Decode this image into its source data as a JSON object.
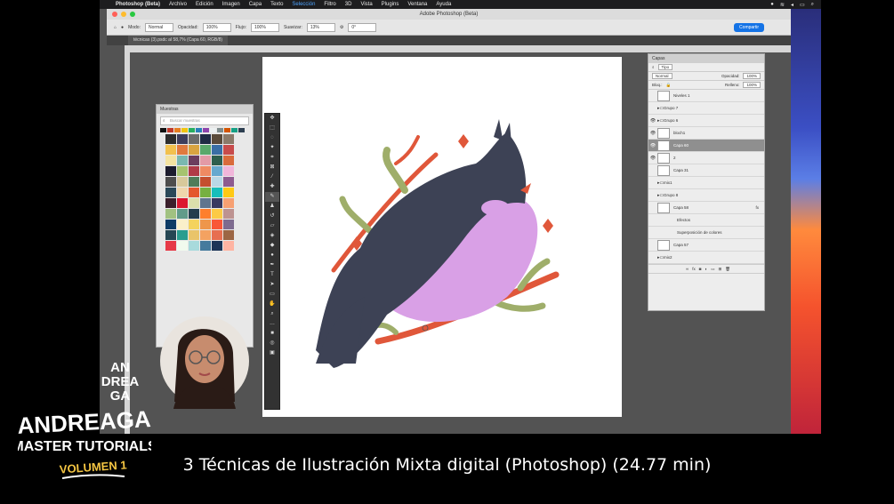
{
  "menubar": {
    "app": "Photoshop (Beta)",
    "items": [
      "Archivo",
      "Edición",
      "Imagen",
      "Capa",
      "Texto",
      "Selección",
      "Filtro",
      "3D",
      "Vista",
      "Plugins",
      "Ventana",
      "Ayuda"
    ],
    "active_item": "Selección"
  },
  "window": {
    "title": "Adobe Photoshop (Beta)",
    "tab": "técnicas (3).psdc al 58,7% (Capa 60, RGB/8)"
  },
  "options": {
    "mode_label": "Modo:",
    "mode": "Normal",
    "opacity_label": "Opacidad:",
    "opacity": "100%",
    "flow_label": "Flujo:",
    "flow": "100%",
    "smooth_label": "Suavizar:",
    "smooth": "13%",
    "angle": "0°",
    "share": "Compartir"
  },
  "swatches": {
    "title": "Muestras",
    "search_placeholder": "Buscar muestras",
    "colors": [
      "#2d2d2d",
      "#3d3d5c",
      "#6b6b6b",
      "#1f2a44",
      "#5a4a3a",
      "#8a7a6a",
      "#f2c14e",
      "#e07a3f",
      "#d9a441",
      "#5aa86b",
      "#3a6ea5",
      "#c74b4b",
      "#f4e3a1",
      "#7ab8b0",
      "#6b3d5e",
      "#e39aa6",
      "#2e5e4e",
      "#d96b3b",
      "#1c1c2e",
      "#a6c36f",
      "#b03a48",
      "#ef8a62",
      "#67a9cf",
      "#f1b6da",
      "#4d4d4d",
      "#d8c99b",
      "#4f7c5a",
      "#c44f2f",
      "#b9d8e6",
      "#8e5b8f",
      "#2a4858",
      "#efd6ac",
      "#e4572e",
      "#76b041",
      "#17bebb",
      "#ffc914",
      "#3b1f2b",
      "#db162f",
      "#dbdfac",
      "#5f758e",
      "#383961",
      "#f7a072",
      "#a1c181",
      "#619b8a",
      "#233d4d",
      "#fe7f2d",
      "#fcca46",
      "#bd9391",
      "#0d3b66",
      "#faf0ca",
      "#f4d35e",
      "#ee964b",
      "#f95738",
      "#7e6b8f",
      "#264653",
      "#2a9d8f",
      "#e9c46a",
      "#f4a261",
      "#e76f51",
      "#9c6644",
      "#e63946",
      "#f1faee",
      "#a8dadc",
      "#457b9d",
      "#1d3557",
      "#ffb4a2"
    ],
    "top_strip": [
      "#111",
      "#c0392b",
      "#e67e22",
      "#f1c40f",
      "#27ae60",
      "#2980b9",
      "#8e44ad",
      "#ecf0f1",
      "#7f8c8d",
      "#d35400",
      "#16a085",
      "#2c3e50"
    ]
  },
  "layers": {
    "title": "Capas",
    "filter": "Tipo",
    "blend": "Normal",
    "opacity_label": "Opacidad:",
    "opacity": "100%",
    "lock_label": "Bloq.:",
    "fill_label": "Relleno:",
    "fill": "100%",
    "rows": [
      {
        "name": "Niveles 1",
        "visible": false,
        "kind": "adjust"
      },
      {
        "name": "Grupo 7",
        "visible": false,
        "kind": "group"
      },
      {
        "name": "Grupo 6",
        "visible": true,
        "kind": "group"
      },
      {
        "name": "bloch1",
        "visible": true,
        "kind": "layer"
      },
      {
        "name": "Capa 60",
        "visible": true,
        "kind": "layer",
        "selected": true
      },
      {
        "name": "2",
        "visible": true,
        "kind": "layer"
      },
      {
        "name": "Capa 31",
        "visible": false,
        "kind": "layer"
      },
      {
        "name": "mix1",
        "visible": false,
        "kind": "group"
      },
      {
        "name": "Grupo 8",
        "visible": false,
        "kind": "group"
      },
      {
        "name": "Capa 58",
        "visible": false,
        "kind": "layer",
        "fx": "fx"
      },
      {
        "name": "Efectos",
        "visible": false,
        "kind": "effect"
      },
      {
        "name": "Superposición de colores",
        "visible": false,
        "kind": "effect"
      },
      {
        "name": "Capa 57",
        "visible": false,
        "kind": "layer"
      },
      {
        "name": "mix2",
        "visible": false,
        "kind": "group"
      }
    ]
  },
  "brand": {
    "logo_small": "AN DREA GA",
    "logo_main": "ANDREAGA",
    "logo_sub": "MASTER TUTORIALS",
    "volume": "VOLUMEN 1"
  },
  "caption": "3 Técnicas de Ilustración Mixta digital (Photoshop) (24.77 min)",
  "colors": {
    "bird_body": "#3d4255",
    "bird_belly": "#d9a0e6",
    "branch": "#e0573a",
    "leaves": "#9fae6a",
    "canvas": "#ffffff",
    "ps_bg": "#535353",
    "accent": "#1473e6"
  },
  "icons": [
    "apple-icon",
    "wifi-icon",
    "battery-icon",
    "search-icon",
    "eye-icon",
    "folder-icon",
    "move-tool-icon",
    "brush-tool-icon",
    "text-tool-icon",
    "zoom-tool-icon",
    "hand-tool-icon"
  ]
}
